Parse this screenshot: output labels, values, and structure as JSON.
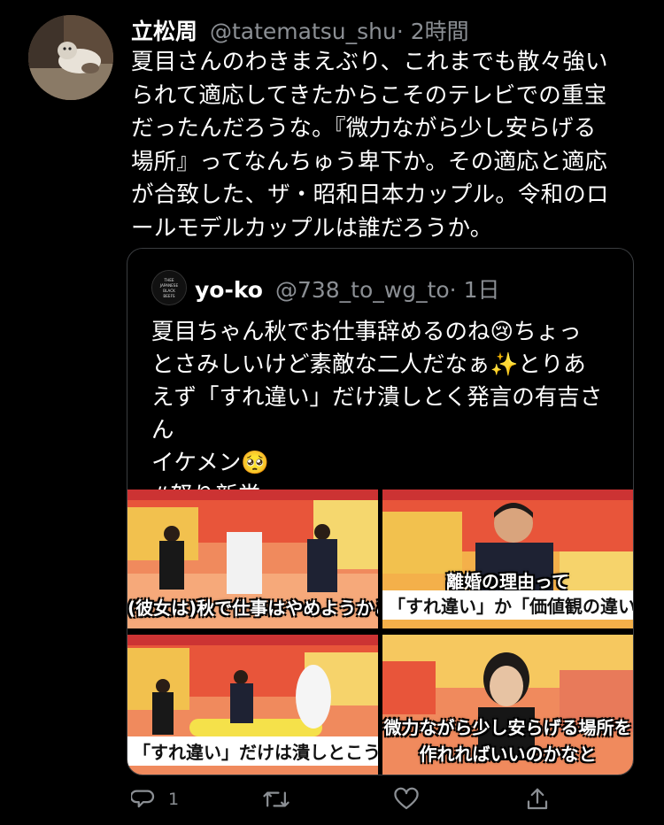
{
  "tweet": {
    "author_name": "立松周",
    "author_handle": "@tatematsu_shu",
    "time": "· 2時間",
    "text_lines": [
      "夏目さんのわきまえぶり、これまでも散々強い",
      "られて適応してきたからこそのテレビでの重宝",
      "だったんだろうな。『微力ながら少し安らげる",
      "場所』ってなんちゅう卑下か。その適応と適応",
      "が合致した、ザ・昭和日本カップル。令和のロ",
      "ールモデルカップルは誰だろうか。"
    ]
  },
  "quoted": {
    "author_name": "yo-ko",
    "author_handle": "@738_to_wg_to",
    "time": "· 1日",
    "avatar_text": "THEE JAPANESE BLACK BEEFS",
    "text_lines": [
      "夏目ちゃん秋でお仕事辞めるのね😢ちょっ",
      "とさみしいけど素敵な二人だなぁ✨とりあ",
      "えず「すれ違い」だけ潰しとく発言の有吉さん",
      "イケメン🥺",
      "#怒り新党"
    ],
    "images": [
      {
        "caption": "(彼女は)秋で仕事はやめようかと"
      },
      {
        "caption_top": "離婚の理由って",
        "caption": "「すれ違い」か「価値観の違い」"
      },
      {
        "caption": "「すれ違い」だけは潰しとこうか"
      },
      {
        "caption_top": "微力ながら少し安らげる場所を",
        "caption": "作れればいいのかなと"
      }
    ]
  },
  "actions": {
    "reply_count": "1"
  },
  "colors": {
    "background": "#000000",
    "secondary_text": "#8b8f94",
    "border": "#3a3d40"
  }
}
